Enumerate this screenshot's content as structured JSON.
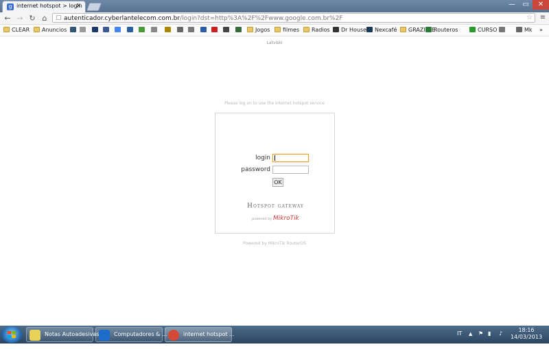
{
  "browser": {
    "tab_title": "internet hotspot > login",
    "tab_close": "✕",
    "url_host": "autenticador.cyberlantelecom.com.br",
    "url_rest": "/login?dst=http%3A%2F%2Fwww.google.com.br%2F",
    "window_controls": {
      "min": "—",
      "max": "▭",
      "close": "✕"
    }
  },
  "bookmarks": [
    {
      "label": "CLEAR",
      "icon": "folder-icon",
      "color": "#e9c86b"
    },
    {
      "label": "Anuncios",
      "icon": "folder-icon",
      "color": "#e9c86b"
    },
    {
      "label": "",
      "icon": "site-icon",
      "color": "#335577"
    },
    {
      "label": "",
      "icon": "site-icon",
      "color": "#999999"
    },
    {
      "label": "",
      "icon": "site-icon",
      "color": "#1b3a6b"
    },
    {
      "label": "",
      "icon": "facebook-icon",
      "color": "#3b5998"
    },
    {
      "label": "",
      "icon": "google-icon",
      "color": "#4285f4"
    },
    {
      "label": "",
      "icon": "k-icon",
      "color": "#2b5fa5"
    },
    {
      "label": "",
      "icon": "site-icon",
      "color": "#4a9a3b"
    },
    {
      "label": "",
      "icon": "site-icon",
      "color": "#888888"
    },
    {
      "label": "",
      "icon": "site-icon",
      "color": "#aa8800"
    },
    {
      "label": "",
      "icon": "site-icon",
      "color": "#666666"
    },
    {
      "label": "",
      "icon": "site-icon",
      "color": "#777777"
    },
    {
      "label": "",
      "icon": "channel4-icon",
      "color": "#2d5ba8"
    },
    {
      "label": "",
      "icon": "youtube-icon",
      "color": "#cc1f1f"
    },
    {
      "label": "",
      "icon": "site-icon",
      "color": "#444444"
    },
    {
      "label": "",
      "icon": "site-icon",
      "color": "#3a6a3a"
    },
    {
      "label": "Jogos",
      "icon": "folder-icon",
      "color": "#e9c86b"
    },
    {
      "label": "filmes",
      "icon": "folder-icon",
      "color": "#e9c86b"
    },
    {
      "label": "Radios",
      "icon": "folder-icon",
      "color": "#e9c86b"
    },
    {
      "label": "Dr House",
      "icon": "site-icon",
      "color": "#333333"
    },
    {
      "label": "Nexcafé",
      "icon": "site-icon",
      "color": "#1a3a5a"
    },
    {
      "label": "GRAZIELE",
      "icon": "folder-icon",
      "color": "#e9c86b"
    },
    {
      "label": "Routeros",
      "icon": "site-icon",
      "color": "#2a7a3a"
    },
    {
      "label": "CURSO",
      "icon": "site-icon",
      "color": "#2a9a2a"
    },
    {
      "label": "",
      "icon": "site-icon",
      "color": "#777777"
    },
    {
      "label": "Mk",
      "icon": "site-icon",
      "color": "#666666"
    },
    {
      "label": "»",
      "icon": "more-icon",
      "color": "#888888"
    }
  ],
  "page": {
    "language": "Latviski",
    "notice": "Please log on to use the internet hotspot service",
    "login_label": "login",
    "password_label": "password",
    "login_value": "",
    "password_value": "",
    "ok_label": "OK",
    "gateway_title": "Hotspot gateway",
    "powered_prefix": "powered by",
    "powered_brand": "MikroTik",
    "footer": "Powered by MikroTik RouterOS"
  },
  "taskbar": {
    "items": [
      {
        "label": "Notas Autoadesivas",
        "icon": "sticky-notes-icon",
        "color": "#e8d25a"
      },
      {
        "label": "Computadores & ...",
        "icon": "teamviewer-icon",
        "color": "#1e6cc8"
      },
      {
        "label": "internet hotspot ...",
        "icon": "chrome-icon",
        "color": "#d34836"
      }
    ],
    "language": "IT",
    "time": "18:16",
    "date": "14/03/2013"
  }
}
